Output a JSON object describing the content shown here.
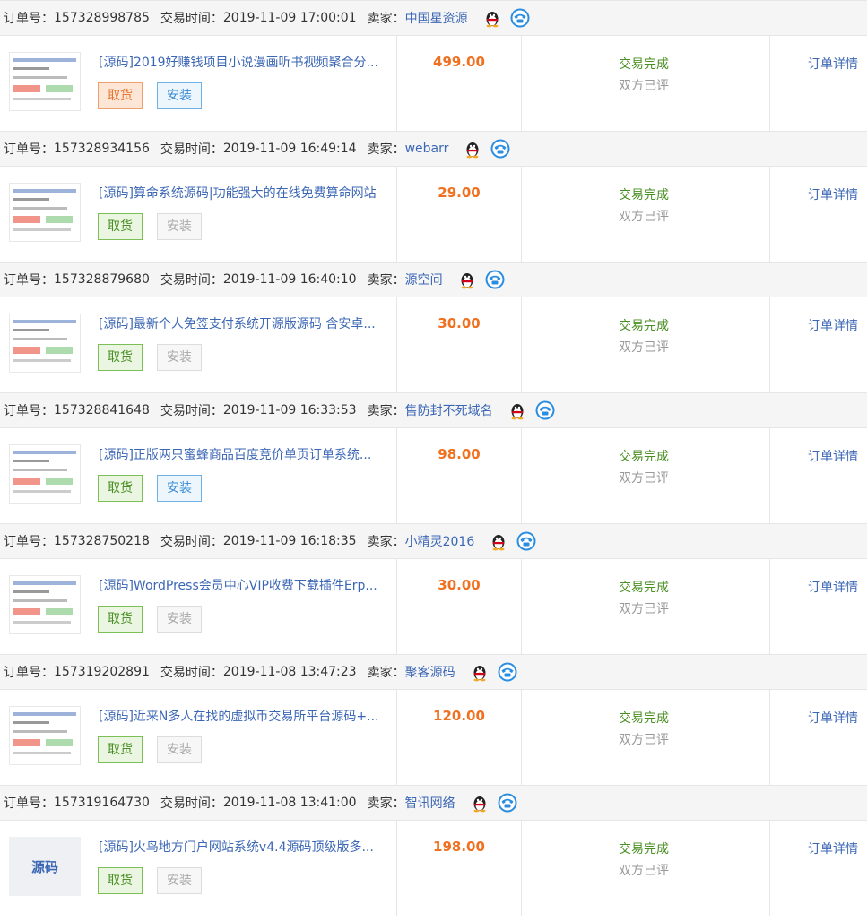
{
  "labels": {
    "order_no": "订单号：",
    "trade_time": "交易时间：",
    "seller": "卖家：",
    "pickup": "取货",
    "install": "安装",
    "status_done": "交易完成",
    "status_review": "双方已评",
    "detail": "订单详情"
  },
  "orders": [
    {
      "order_no": "157328998785",
      "time": "2019-11-09 17:00:01",
      "seller": "中国星资源",
      "title": "[源码]2019好赚钱项目小说漫画听书视频聚合分...",
      "price": "499.00",
      "pickup_style": "orange",
      "install_style": "blue",
      "thumb_text": ""
    },
    {
      "order_no": "157328934156",
      "time": "2019-11-09 16:49:14",
      "seller": "webarr",
      "title": "[源码]算命系统源码|功能强大的在线免费算命网站",
      "price": "29.00",
      "pickup_style": "green",
      "install_style": "gray",
      "thumb_text": ""
    },
    {
      "order_no": "157328879680",
      "time": "2019-11-09 16:40:10",
      "seller": "源空间",
      "title": "[源码]最新个人免签支付系统开源版源码 含安卓...",
      "price": "30.00",
      "pickup_style": "green",
      "install_style": "gray",
      "thumb_text": ""
    },
    {
      "order_no": "157328841648",
      "time": "2019-11-09 16:33:53",
      "seller": "售防封不死域名",
      "title": "[源码]正版两只蜜蜂商品百度竞价单页订单系统...",
      "price": "98.00",
      "pickup_style": "green",
      "install_style": "blue",
      "thumb_text": ""
    },
    {
      "order_no": "157328750218",
      "time": "2019-11-09 16:18:35",
      "seller": "小精灵2016",
      "title": "[源码]WordPress会员中心VIP收费下载插件Erp...",
      "price": "30.00",
      "pickup_style": "green",
      "install_style": "gray",
      "thumb_text": ""
    },
    {
      "order_no": "157319202891",
      "time": "2019-11-08 13:47:23",
      "seller": "聚客源码",
      "title": "[源码]近来N多人在找的虚拟币交易所平台源码+...",
      "price": "120.00",
      "pickup_style": "green",
      "install_style": "gray",
      "thumb_text": ""
    },
    {
      "order_no": "157319164730",
      "time": "2019-11-08 13:41:00",
      "seller": "智讯网络",
      "title": "[源码]火鸟地方门户网站系统v4.4源码顶级版多...",
      "price": "198.00",
      "pickup_style": "green",
      "install_style": "gray",
      "thumb_text": "源码"
    }
  ],
  "icons": {
    "qq": "qq-penguin-icon",
    "phone": "phone-icon"
  },
  "colors": {
    "link": "#3c67b5",
    "price": "#f07020",
    "success": "#4a8f23"
  }
}
